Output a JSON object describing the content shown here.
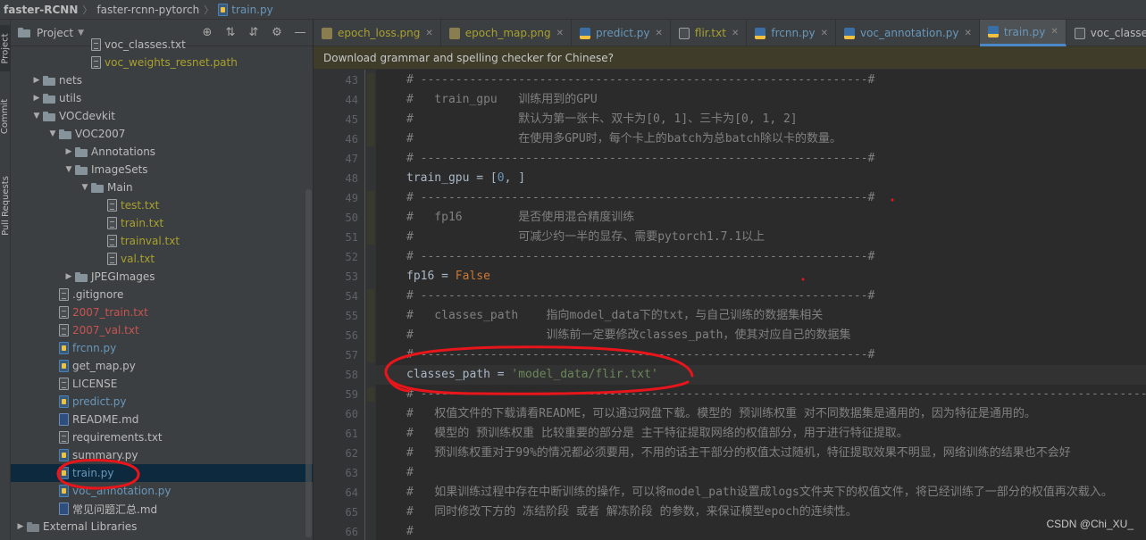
{
  "breadcrumb": {
    "project": "faster-RCNN",
    "folder": "faster-rcnn-pytorch",
    "file": "train.py"
  },
  "tool_strip": {
    "project": "Project",
    "commit": "Commit",
    "pull_requests": "Pull Requests"
  },
  "project_panel": {
    "title": "Project",
    "items": [
      {
        "label": "voc_classes.txt",
        "depth": 5,
        "type": "txt",
        "color": "default"
      },
      {
        "label": "voc_weights_resnet.path",
        "depth": 5,
        "type": "file",
        "color": "yellow"
      },
      {
        "label": "nets",
        "depth": 2,
        "type": "folder",
        "arrow": "collapsed"
      },
      {
        "label": "utils",
        "depth": 2,
        "type": "folder",
        "arrow": "collapsed"
      },
      {
        "label": "VOCdevkit",
        "depth": 2,
        "type": "folder",
        "arrow": "expanded"
      },
      {
        "label": "VOC2007",
        "depth": 3,
        "type": "folder",
        "arrow": "expanded"
      },
      {
        "label": "Annotations",
        "depth": 4,
        "type": "folder",
        "arrow": "collapsed"
      },
      {
        "label": "ImageSets",
        "depth": 4,
        "type": "folder",
        "arrow": "expanded"
      },
      {
        "label": "Main",
        "depth": 5,
        "type": "folder",
        "arrow": "expanded"
      },
      {
        "label": "test.txt",
        "depth": 6,
        "type": "txt",
        "color": "yellow"
      },
      {
        "label": "train.txt",
        "depth": 6,
        "type": "txt",
        "color": "yellow"
      },
      {
        "label": "trainval.txt",
        "depth": 6,
        "type": "txt",
        "color": "yellow"
      },
      {
        "label": "val.txt",
        "depth": 6,
        "type": "txt",
        "color": "yellow"
      },
      {
        "label": "JPEGImages",
        "depth": 4,
        "type": "folder",
        "arrow": "collapsed"
      },
      {
        "label": ".gitignore",
        "depth": 3,
        "type": "file",
        "color": "default"
      },
      {
        "label": "2007_train.txt",
        "depth": 3,
        "type": "txt",
        "color": "red"
      },
      {
        "label": "2007_val.txt",
        "depth": 3,
        "type": "txt",
        "color": "red"
      },
      {
        "label": "frcnn.py",
        "depth": 3,
        "type": "py",
        "color": "blue"
      },
      {
        "label": "get_map.py",
        "depth": 3,
        "type": "py",
        "color": "default"
      },
      {
        "label": "LICENSE",
        "depth": 3,
        "type": "txt",
        "color": "default"
      },
      {
        "label": "predict.py",
        "depth": 3,
        "type": "py",
        "color": "blue"
      },
      {
        "label": "README.md",
        "depth": 3,
        "type": "md",
        "color": "default"
      },
      {
        "label": "requirements.txt",
        "depth": 3,
        "type": "txt",
        "color": "default"
      },
      {
        "label": "summary.py",
        "depth": 3,
        "type": "py",
        "color": "default"
      },
      {
        "label": "train.py",
        "depth": 3,
        "type": "py",
        "color": "blue",
        "selected": true
      },
      {
        "label": "voc_annotation.py",
        "depth": 3,
        "type": "py",
        "color": "blue"
      },
      {
        "label": "常见问题汇总.md",
        "depth": 3,
        "type": "md",
        "color": "default"
      },
      {
        "label": "External Libraries",
        "depth": 1,
        "type": "library",
        "arrow": "collapsed"
      }
    ]
  },
  "tabs": [
    {
      "label": "epoch_loss.png",
      "kind": "img"
    },
    {
      "label": "epoch_map.png",
      "kind": "img"
    },
    {
      "label": "predict.py",
      "kind": "py"
    },
    {
      "label": "flir.txt",
      "kind": "txt"
    },
    {
      "label": "frcnn.py",
      "kind": "py"
    },
    {
      "label": "voc_annotation.py",
      "kind": "py"
    },
    {
      "label": "train.py",
      "kind": "py",
      "active": true
    },
    {
      "label": "voc_classes.txt",
      "kind": "txt-plain"
    }
  ],
  "notification": {
    "text": "Download grammar and spelling checker for Chinese?"
  },
  "code": {
    "lines": [
      {
        "n": "43",
        "parts": [
          [
            "comment",
            "# ----------------------------------------------------------------#"
          ]
        ]
      },
      {
        "n": "44",
        "parts": [
          [
            "comment",
            "#   train_gpu   训练用到的GPU"
          ]
        ]
      },
      {
        "n": "45",
        "parts": [
          [
            "comment",
            "#               默认为第一张卡、双卡为[0, 1]、三卡为[0, 1, 2]"
          ]
        ]
      },
      {
        "n": "46",
        "parts": [
          [
            "comment",
            "#               在使用多GPU时，每个卡上的batch为总batch除以卡的数量。"
          ]
        ]
      },
      {
        "n": "47",
        "parts": [
          [
            "comment",
            "# ----------------------------------------------------------------#"
          ]
        ]
      },
      {
        "n": "48",
        "parts": [
          [
            "ident",
            "train_gpu = ["
          ],
          [
            "num",
            "0"
          ],
          [
            "ident",
            ", ]"
          ]
        ]
      },
      {
        "n": "49",
        "parts": [
          [
            "comment",
            "# ----------------------------------------------------------------#"
          ]
        ]
      },
      {
        "n": "50",
        "parts": [
          [
            "comment",
            "#   fp16        是否使用混合精度训练"
          ]
        ]
      },
      {
        "n": "51",
        "parts": [
          [
            "comment",
            "#               可减少约一半的显存、需要pytorch1.7.1以上"
          ]
        ]
      },
      {
        "n": "52",
        "parts": [
          [
            "comment",
            "# ----------------------------------------------------------------#"
          ]
        ]
      },
      {
        "n": "53",
        "parts": [
          [
            "ident",
            "fp16 = "
          ],
          [
            "kw",
            "False"
          ]
        ]
      },
      {
        "n": "54",
        "parts": [
          [
            "comment",
            "# ----------------------------------------------------------------#"
          ]
        ]
      },
      {
        "n": "55",
        "parts": [
          [
            "comment",
            "#   classes_path    指向model_data下的txt，与自己训练的数据集相关"
          ]
        ]
      },
      {
        "n": "56",
        "parts": [
          [
            "comment",
            "#                   训练前一定要修改classes_path，使其对应自己的数据集"
          ]
        ]
      },
      {
        "n": "57",
        "parts": [
          [
            "comment",
            "# ----------------------------------------------------------------#"
          ]
        ]
      },
      {
        "n": "58",
        "parts": [
          [
            "ident",
            "classes_path = "
          ],
          [
            "str",
            "'model_data/flir.txt'"
          ]
        ]
      },
      {
        "n": "59",
        "parts": [
          [
            "comment",
            "# --------------------------------------------------------------------------------------------------------"
          ]
        ]
      },
      {
        "n": "60",
        "parts": [
          [
            "comment",
            "#   权值文件的下载请看README，可以通过网盘下载。模型的 预训练权重 对不同数据集是通用的，因为特征是通用的。"
          ]
        ]
      },
      {
        "n": "61",
        "parts": [
          [
            "comment",
            "#   模型的 预训练权重 比较重要的部分是 主干特征提取网络的权值部分，用于进行特征提取。"
          ]
        ]
      },
      {
        "n": "62",
        "parts": [
          [
            "comment",
            "#   预训练权重对于99%的情况都必须要用，不用的话主干部分的权值太过随机，特征提取效果不明显，网络训练的结果也不会好"
          ]
        ]
      },
      {
        "n": "63",
        "parts": [
          [
            "comment",
            "#"
          ]
        ]
      },
      {
        "n": "64",
        "parts": [
          [
            "comment",
            "#   如果训练过程中存在中断训练的操作，可以将model_path设置成logs文件夹下的权值文件，将已经训练了一部分的权值再次载入。"
          ]
        ]
      },
      {
        "n": "65",
        "parts": [
          [
            "comment",
            "#   同时修改下方的 冻结阶段 或者 解冻阶段 的参数，来保证模型epoch的连续性。"
          ]
        ]
      },
      {
        "n": "66",
        "parts": [
          [
            "comment",
            "#"
          ]
        ]
      }
    ]
  },
  "watermark": "CSDN @Chi_XU_",
  "colors": {
    "accent": "#4a88c7",
    "annotation": "#e8151b",
    "selection": "#0d293e"
  },
  "icons": [
    "folder-icon",
    "text-file-icon",
    "python-file-icon",
    "markdown-file-icon",
    "gear-icon",
    "locate-icon",
    "expand-all-icon",
    "collapse-all-icon",
    "minimize-icon",
    "close-icon"
  ]
}
